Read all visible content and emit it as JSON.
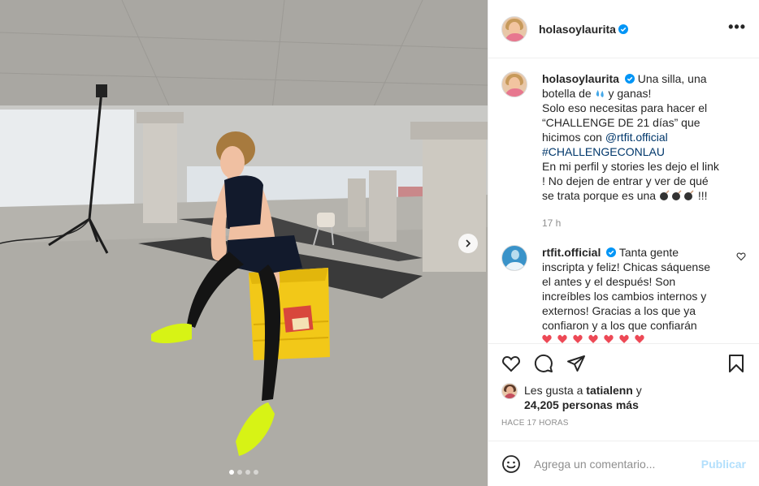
{
  "post": {
    "author": "holasoylaurita",
    "more_label": "•••",
    "caption": {
      "username": "holasoylaurita",
      "part1": "Una silla, una botella de",
      "part2": "y ganas!",
      "part3": "Solo eso necesitas para hacer el “CHALLENGE DE 21 días” que hicimos con",
      "mention": "@rtfit.official",
      "hashtag": "#CHALLENGECONLAU",
      "part4": "En mi perfil y stories les dejo el link ! No dejen de entrar y ver de qué se trata porque es una",
      "part5": "!!!",
      "time": "17 h"
    },
    "comment": {
      "username": "rtfit.official",
      "text": "Tanta gente inscripta y feliz! Chicas sáquense el antes y el después! Son increíbles los cambios internos y externos! Gracias a los que ya confiaron y a los que confiarán"
    },
    "likes": {
      "prefix": "Les gusta a",
      "liked_by": "tatialenn",
      "connector": "y",
      "count": "24,205 personas más"
    },
    "time_ago": "HACE 17 HORAS",
    "add_comment": {
      "placeholder": "Agrega un comentario...",
      "publish": "Publicar"
    },
    "carousel": {
      "total": 4,
      "active": 1
    }
  },
  "colors": {
    "verified": "#0095f6",
    "link": "#00376b",
    "publish_disabled": "#b2dffc",
    "heart_red": "#ed4956"
  },
  "icons": {
    "actions": [
      "heart-icon",
      "comment-icon",
      "share-icon",
      "save-icon"
    ],
    "emoji": [
      "droplet-emoji",
      "bomb-emoji",
      "red-heart-emoji"
    ]
  }
}
